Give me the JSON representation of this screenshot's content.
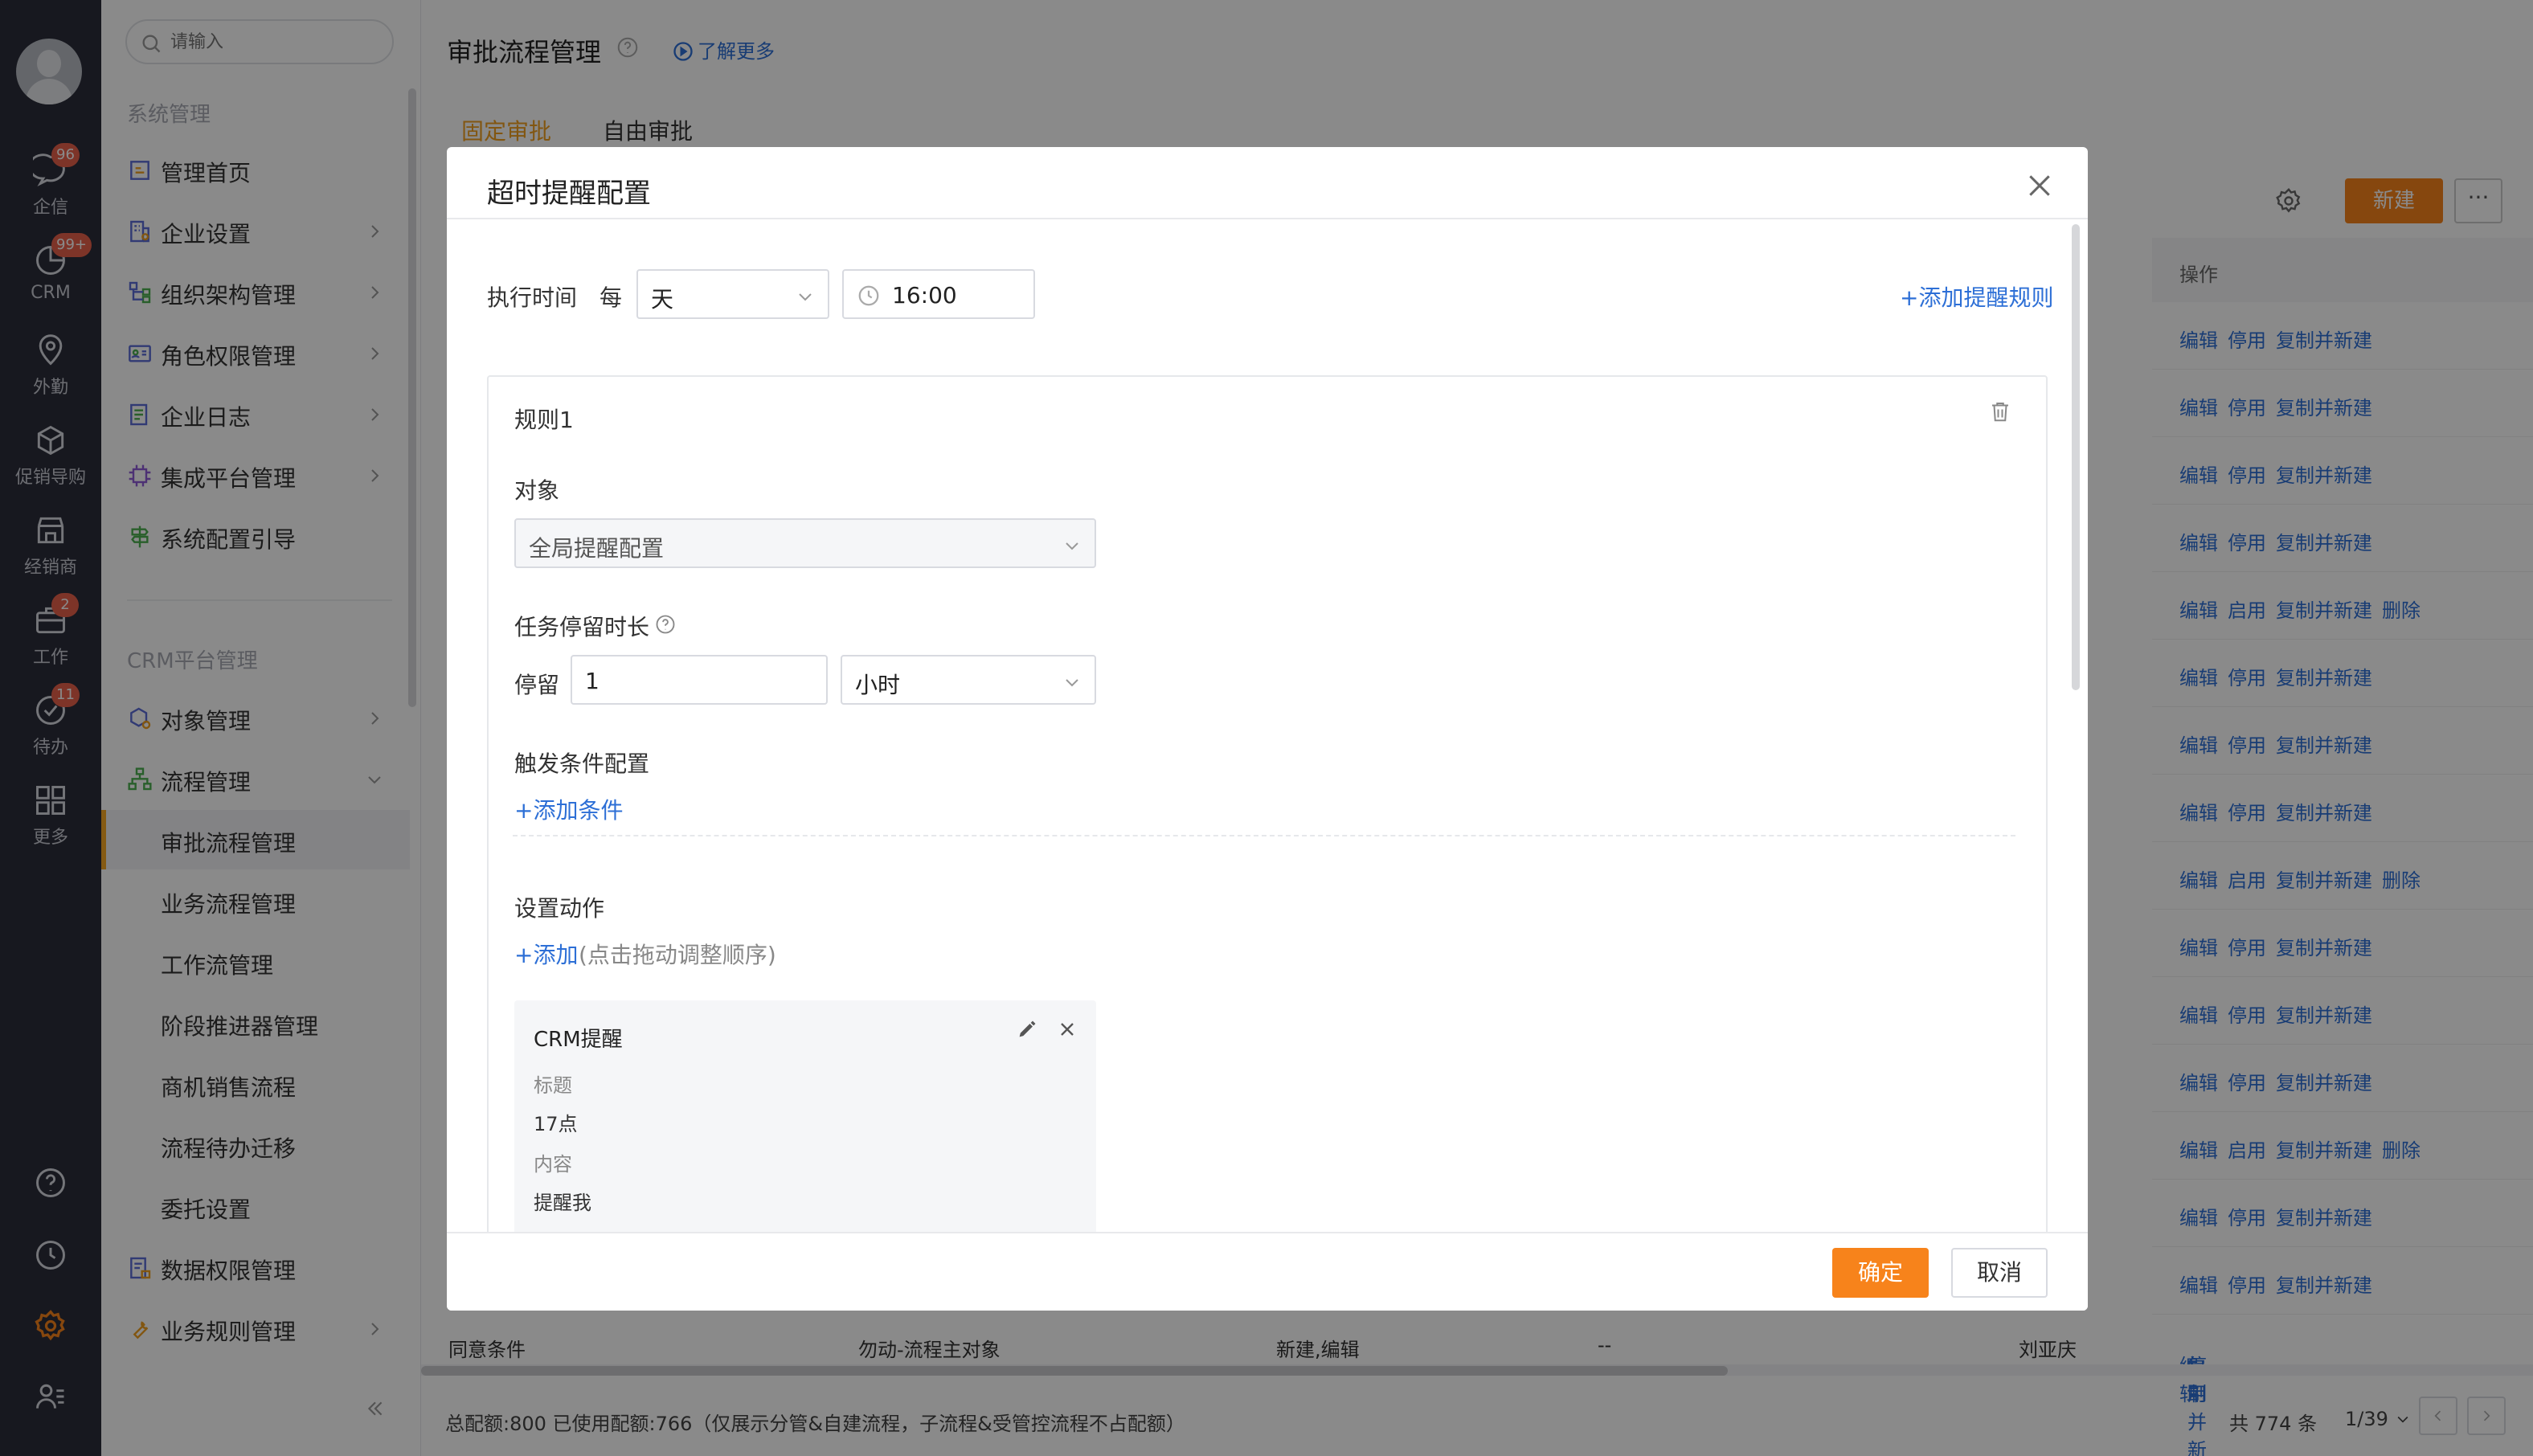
{
  "rail": {
    "items": [
      {
        "label": "企信",
        "badge": "96",
        "icon": "chat-icon"
      },
      {
        "label": "CRM",
        "badge": "99+",
        "icon": "crm-icon"
      },
      {
        "label": "外勤",
        "badge": "",
        "icon": "location-icon"
      },
      {
        "label": "促销导购",
        "badge": "",
        "icon": "box-icon"
      },
      {
        "label": "经销商",
        "badge": "",
        "icon": "store-icon"
      },
      {
        "label": "工作",
        "badge": "2",
        "icon": "briefcase-icon"
      },
      {
        "label": "待办",
        "badge": "11",
        "icon": "check-circle-icon"
      },
      {
        "label": "更多",
        "badge": "",
        "icon": "grid-icon"
      }
    ]
  },
  "sidebar": {
    "search_placeholder": "请输入",
    "section1": "系统管理",
    "section2": "CRM平台管理",
    "menu1": [
      {
        "label": "管理首页",
        "icon": "home-icon",
        "chevron": false
      },
      {
        "label": "企业设置",
        "icon": "building-icon",
        "chevron": true
      },
      {
        "label": "组织架构管理",
        "icon": "org-icon",
        "chevron": true
      },
      {
        "label": "角色权限管理",
        "icon": "id-card-icon",
        "chevron": true
      },
      {
        "label": "企业日志",
        "icon": "log-icon",
        "chevron": true
      },
      {
        "label": "集成平台管理",
        "icon": "chip-icon",
        "chevron": true
      },
      {
        "label": "系统配置引导",
        "icon": "signpost-icon",
        "chevron": false
      }
    ],
    "object_mgmt": "对象管理",
    "process_mgmt": "流程管理",
    "sub_items": [
      "审批流程管理",
      "业务流程管理",
      "工作流管理",
      "阶段推进器管理",
      "商机销售流程",
      "流程待办迁移",
      "委托设置"
    ],
    "data_perm": "数据权限管理",
    "biz_rules": "业务规则管理"
  },
  "header": {
    "title": "审批流程管理",
    "learn_more": "了解更多"
  },
  "tabs": {
    "fixed": "固定审批",
    "free": "自由审批"
  },
  "toolbar": {
    "new_label": "新建",
    "more_label": "···"
  },
  "table": {
    "ops_header": "操作",
    "rows": [
      [
        "编辑",
        "停用",
        "复制并新建"
      ],
      [
        "编辑",
        "停用",
        "复制并新建"
      ],
      [
        "编辑",
        "停用",
        "复制并新建"
      ],
      [
        "编辑",
        "停用",
        "复制并新建"
      ],
      [
        "编辑",
        "启用",
        "复制并新建",
        "删除"
      ],
      [
        "编辑",
        "停用",
        "复制并新建"
      ],
      [
        "编辑",
        "停用",
        "复制并新建"
      ],
      [
        "编辑",
        "停用",
        "复制并新建"
      ],
      [
        "编辑",
        "启用",
        "复制并新建",
        "删除"
      ],
      [
        "编辑",
        "停用",
        "复制并新建"
      ],
      [
        "编辑",
        "停用",
        "复制并新建"
      ],
      [
        "编辑",
        "停用",
        "复制并新建"
      ],
      [
        "编辑",
        "启用",
        "复制并新建",
        "删除"
      ],
      [
        "编辑",
        "停用",
        "复制并新建"
      ],
      [
        "编辑",
        "停用",
        "复制并新建"
      ]
    ],
    "last_row": {
      "name": "同意条件",
      "object": "勿动-流程主对象",
      "trigger": "新建,编辑",
      "dash": "--",
      "owner": "刘亚庆",
      "ops": [
        "编辑",
        "停用",
        "复制并新建"
      ]
    }
  },
  "footer": {
    "quota": "总配额:800 已使用配额:766（仅展示分管&自建流程，子流程&受管控流程不占配额）",
    "total": "共 774 条",
    "page": "1/39"
  },
  "dialog": {
    "title": "超时提醒配置",
    "exec_time_label": "执行时间",
    "every": "每",
    "period": "天",
    "time": "16:00",
    "add_rule": "+添加提醒规则",
    "rule_title": "规则1",
    "object_label": "对象",
    "object_value": "全局提醒配置",
    "stay_label": "任务停留时长",
    "stay_prefix": "停留",
    "stay_value": "1",
    "stay_unit": "小时",
    "trigger_label": "触发条件配置",
    "add_condition": "+添加条件",
    "action_label": "设置动作",
    "add_action": "+添加",
    "add_action_hint": "(点击拖动调整顺序)",
    "action_card": {
      "type": "CRM提醒",
      "title_key": "标题",
      "title_value": "17点",
      "content_key": "内容",
      "content_value": "提醒我"
    },
    "ok": "确定",
    "cancel": "取消"
  },
  "colors": {
    "accent": "#f7831b",
    "link": "#2d6fd6",
    "rail": "#2b2d3a"
  }
}
